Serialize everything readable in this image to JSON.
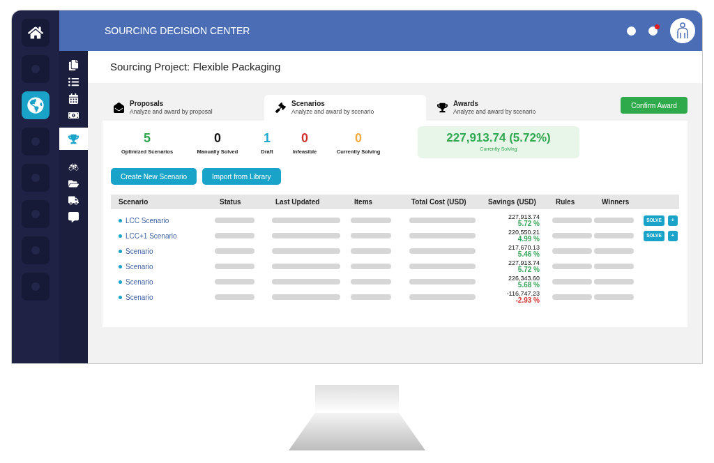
{
  "header": {
    "title": "SOURCING DECISION CENTER",
    "notification_badge": true
  },
  "rail": [
    {
      "selected": false
    },
    {
      "selected": true
    },
    {
      "selected": false
    },
    {
      "selected": false
    },
    {
      "selected": false
    },
    {
      "selected": false
    },
    {
      "selected": false
    }
  ],
  "nav": [
    {
      "kind": "documents",
      "selected": false
    },
    {
      "kind": "list",
      "selected": false
    },
    {
      "kind": "calendar",
      "selected": false
    },
    {
      "kind": "money",
      "selected": false
    },
    {
      "kind": "trophy",
      "selected": true
    },
    {
      "kind": "binoculars",
      "selected": false
    },
    {
      "kind": "folder",
      "selected": false
    },
    {
      "kind": "truck",
      "selected": false
    },
    {
      "kind": "chat",
      "selected": false
    }
  ],
  "page_title": "Sourcing Project: Flexible Packaging",
  "tabs": [
    {
      "kind": "envelope",
      "title": "Proposals",
      "subtitle": "Analyze and award by proposal",
      "selected": false
    },
    {
      "kind": "gavel",
      "title": "Scenarios",
      "subtitle": "Analyze and award by scenario",
      "selected": true
    },
    {
      "kind": "trophy",
      "title": "Awards",
      "subtitle": "Analyze and award by scenario",
      "selected": false
    }
  ],
  "confirm_button": "Confirm Award",
  "stats": [
    {
      "value": "5",
      "label": "Optimized Scenarios",
      "color": "#2fa84f"
    },
    {
      "value": "0",
      "label": "Manually Solved",
      "color": "#111111"
    },
    {
      "value": "1",
      "label": "Draft",
      "color": "#1ea7d1"
    },
    {
      "value": "0",
      "label": "Infeasible",
      "color": "#d0312d"
    },
    {
      "value": "0",
      "label": "Currently Solving",
      "color": "#f2a93b"
    }
  ],
  "summary": {
    "value": "227,913.74 (5.72%)",
    "label": "Currently Solving"
  },
  "actions": [
    "Create New Scenario",
    "Import from Library"
  ],
  "table": {
    "columns": [
      "Scenario",
      "Status",
      "Last Updated",
      "Items",
      "Total Cost (USD)",
      "Savings (USD)",
      "Rules",
      "Winners"
    ],
    "rows": [
      {
        "name": "LCC Scenario",
        "savings": "227,913.74",
        "percent": "5.72 %",
        "color": "#3aa65a",
        "buttons": [
          "SOLVE",
          "+"
        ]
      },
      {
        "name": "LCC+1 Scenario",
        "savings": "220,550.21",
        "percent": "4.99 %",
        "color": "#3aa65a",
        "buttons": [
          "SOLVE",
          "+"
        ]
      },
      {
        "name": "Scenario",
        "savings": "217,670.13",
        "percent": "5.46 %",
        "color": "#3aa65a"
      },
      {
        "name": "Scenario",
        "savings": "227,913.74",
        "percent": "5.72 %",
        "color": "#3aa65a"
      },
      {
        "name": "Scenario",
        "savings": "226,343.60",
        "percent": "5.68 %",
        "color": "#3aa65a"
      },
      {
        "name": "Scenario",
        "savings": "-116,747.23",
        "percent": "-2.93 %",
        "color": "#d0312d"
      }
    ]
  }
}
